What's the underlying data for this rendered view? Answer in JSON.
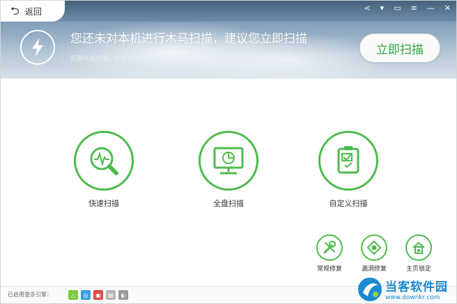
{
  "header": {
    "back_label": "返回",
    "headline": "您还未对本机进行木马扫描，建议您立即扫描",
    "subline": "定期木马扫描、优化系统设置，时刻保持电脑健康",
    "scan_now_label": "立即扫描",
    "sys_icons": [
      "share-icon",
      "shirt-icon",
      "message-icon",
      "menu-icon",
      "minimize-icon",
      "close-icon"
    ]
  },
  "scan_options": [
    {
      "label": "快速扫描",
      "icon": "pulse-magnifier-icon"
    },
    {
      "label": "全盘扫描",
      "icon": "monitor-icon"
    },
    {
      "label": "自定义扫描",
      "icon": "checklist-icon"
    }
  ],
  "tools": [
    {
      "label": "常规修复",
      "icon": "wrench-icon"
    },
    {
      "label": "漏洞修复",
      "icon": "patch-icon"
    },
    {
      "label": "主页锁定",
      "icon": "home-lock-icon"
    }
  ],
  "footer": {
    "engine_label": "已启用查杀引擎：",
    "engines": [
      {
        "name": "cloud-engine",
        "color": "#7ac943"
      },
      {
        "name": "qvm-engine",
        "color": "#3aa0e0"
      },
      {
        "name": "bitdefender-engine",
        "color": "#e24a4a"
      },
      {
        "name": "system-repair-engine",
        "color": "#b7b7b7"
      },
      {
        "name": "avira-engine",
        "color": "#9a9a9a"
      }
    ]
  },
  "watermark": {
    "title": "当客软件园",
    "url": "www.downkr.com"
  },
  "colors": {
    "accent_green": "#4cbb4c",
    "button_text_green": "#2aa63d",
    "watermark_blue": "#1a8ad2"
  }
}
